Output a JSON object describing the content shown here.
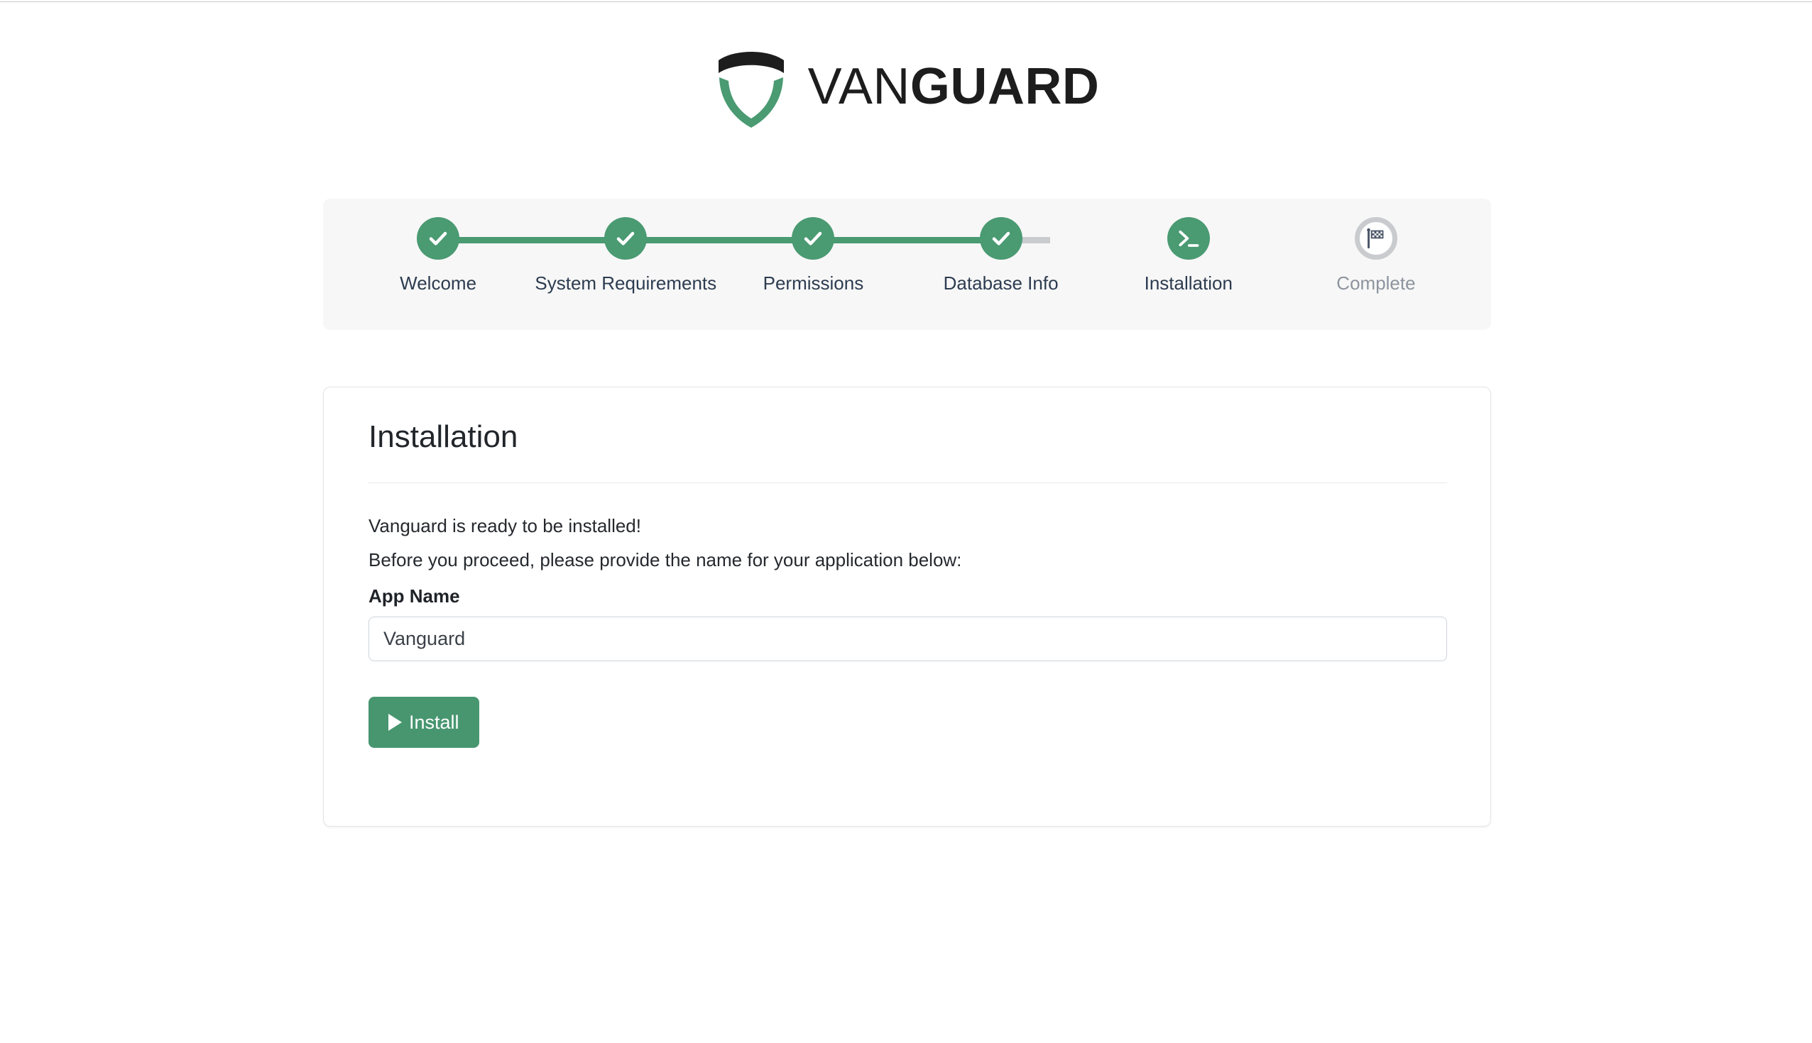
{
  "brand": {
    "name_part1": "VAN",
    "name_part2": "GUARD",
    "logo_icon": "shield-logo-icon",
    "dark_color": "#1d1d1d",
    "green_color": "#4a9a72"
  },
  "stepper": {
    "panel_background": "#f7f7f7",
    "active_color": "#4a9a72",
    "inactive_color": "#c9cbcf",
    "steps": [
      {
        "label": "Welcome",
        "state": "done",
        "icon": "check-icon"
      },
      {
        "label": "System Requirements",
        "state": "done",
        "icon": "check-icon"
      },
      {
        "label": "Permissions",
        "state": "done",
        "icon": "check-icon"
      },
      {
        "label": "Database Info",
        "state": "done",
        "icon": "check-icon"
      },
      {
        "label": "Installation",
        "state": "current",
        "icon": "terminal-prompt-icon"
      },
      {
        "label": "Complete",
        "state": "pending",
        "icon": "checkered-flag-icon"
      }
    ]
  },
  "card": {
    "title": "Installation",
    "paragraph_1": "Vanguard is ready to be installed!",
    "paragraph_2": "Before you proceed, please provide the name for your application below:",
    "field": {
      "label": "App Name",
      "value": "Vanguard",
      "placeholder": "App Name"
    },
    "install_button": {
      "label": "Install",
      "icon": "play-icon",
      "color": "#479670"
    }
  }
}
